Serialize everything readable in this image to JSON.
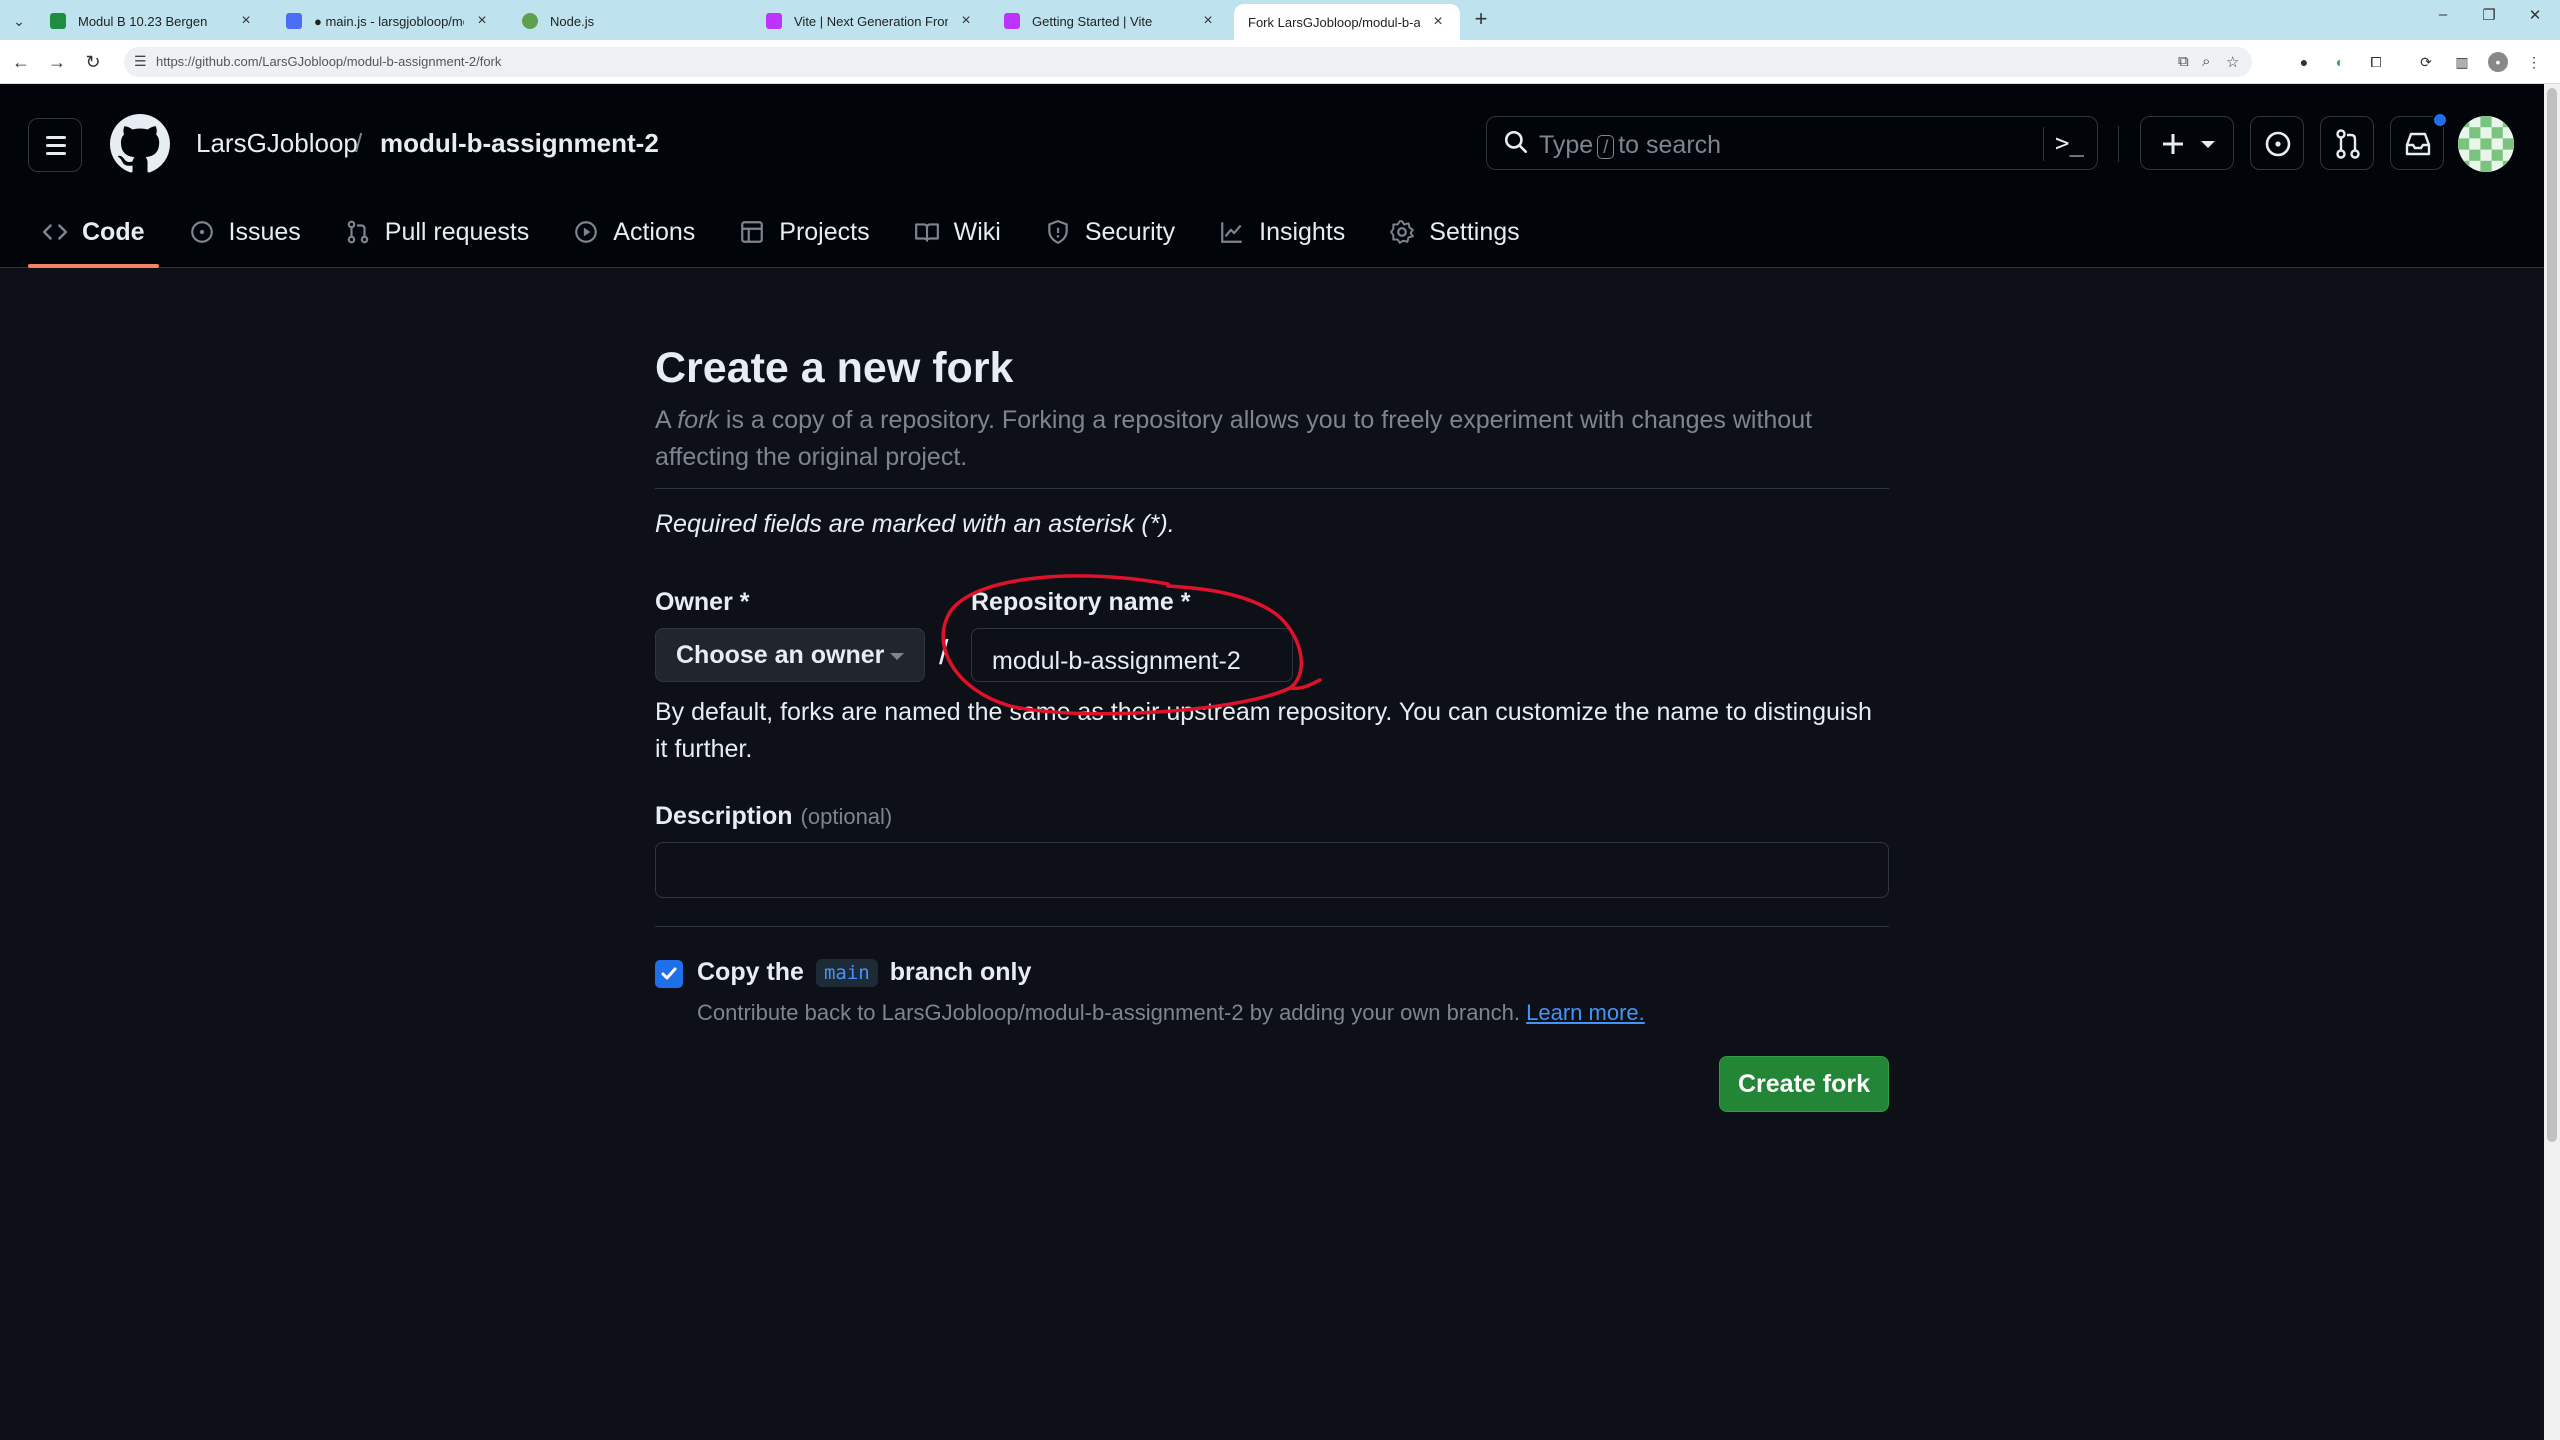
{
  "browser": {
    "tabs": [
      {
        "title": "Modul B 10.23 Bergen",
        "favicon_color": "#1e8e3e",
        "active": false
      },
      {
        "title": "● main.js - larsgjobloop/modul",
        "favicon_color": "#4c6ef5",
        "active": false
      },
      {
        "title": "Node.js",
        "favicon_color": "#5fa04e",
        "active": false
      },
      {
        "title": "Vite | Next Generation Frontend",
        "favicon_color": "#bd34fe",
        "active": false
      },
      {
        "title": "Getting Started | Vite",
        "favicon_color": "#bd34fe",
        "active": false
      },
      {
        "title": "Fork LarsGJobloop/modul-b-as",
        "favicon_color": "#ffffff",
        "active": true
      }
    ],
    "url": "https://github.com/LarsGJobloop/modul-b-assignment-2/fork"
  },
  "header": {
    "owner": "LarsGJobloop",
    "separator": "/",
    "repo": "modul-b-assignment-2",
    "search_pre": "Type",
    "search_key": "/",
    "search_post": "to search",
    "command_glyph": ">_"
  },
  "repo_nav": [
    {
      "label": "Code",
      "icon": "code-icon",
      "active": true
    },
    {
      "label": "Issues",
      "icon": "issue-icon",
      "active": false
    },
    {
      "label": "Pull requests",
      "icon": "pull-request-icon",
      "active": false
    },
    {
      "label": "Actions",
      "icon": "play-icon",
      "active": false
    },
    {
      "label": "Projects",
      "icon": "table-icon",
      "active": false
    },
    {
      "label": "Wiki",
      "icon": "book-icon",
      "active": false
    },
    {
      "label": "Security",
      "icon": "shield-icon",
      "active": false
    },
    {
      "label": "Insights",
      "icon": "graph-icon",
      "active": false
    },
    {
      "label": "Settings",
      "icon": "gear-icon",
      "active": false
    }
  ],
  "form": {
    "title": "Create a new fork",
    "intro_pre": "A ",
    "intro_em": "fork",
    "intro_post": " is a copy of a repository. Forking a repository allows you to freely experiment with changes without affecting the original project.",
    "required_note": "Required fields are marked with an asterisk (*).",
    "owner_label": "Owner *",
    "owner_placeholder": "Choose an owner",
    "slash": "/",
    "repo_label": "Repository name *",
    "repo_value": "modul-b-assignment-2",
    "name_hint": "By default, forks are named the same as their upstream repository. You can customize the name to distinguish it further.",
    "description_label": "Description",
    "description_optional": "(optional)",
    "description_value": "",
    "copy_pre": "Copy the",
    "copy_branch": "main",
    "copy_post": "branch only",
    "copy_checked": true,
    "contrib_text": "Contribute back to LarsGJobloop/modul-b-assignment-2 by adding your own branch.",
    "learn_more": "Learn more.",
    "create_button": "Create fork"
  },
  "colors": {
    "accent": "#1f6feb",
    "create": "#238636",
    "annotation": "#e0112b",
    "tab_underline": "#f78166"
  }
}
